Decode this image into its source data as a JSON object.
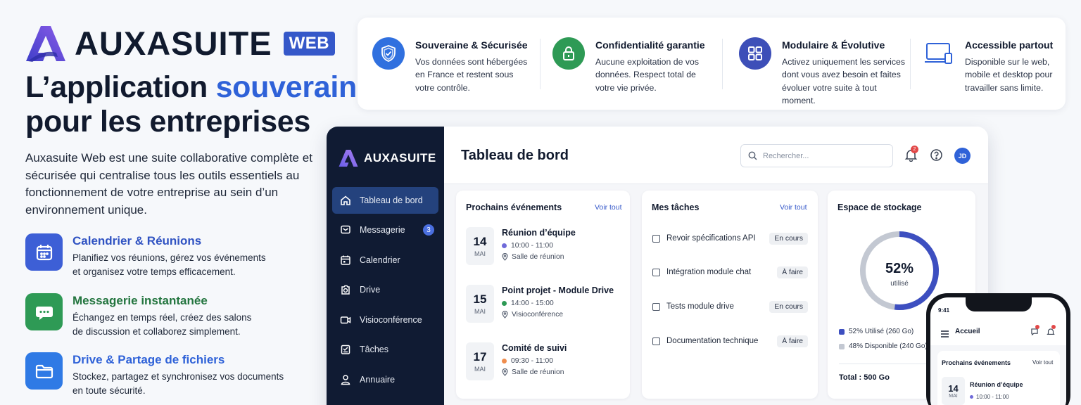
{
  "brand": {
    "name": "AUXASUITE",
    "tag": "WEB"
  },
  "headline": {
    "part1": "L’application ",
    "highlight": "souveraine",
    "line2": "pour les entreprises"
  },
  "intro": "Auxasuite Web est une suite collaborative complète et sécurisée qui centralise tous les outils essentiels au fonctionnement de votre entreprise au sein d’un environnement unique.",
  "features": [
    {
      "title": "Calendrier & Réunions",
      "desc1": "Planifiez vos réunions, gérez vos événements",
      "desc2": "et organisez votre temps efficacement.",
      "color": "#3d5fd6",
      "icon": "calendar-icon"
    },
    {
      "title": "Messagerie instantanée",
      "desc1": "Échangez en temps réel, créez des salons",
      "desc2": "de discussion et collaborez simplement.",
      "color": "#2e9a55",
      "icon": "chat-icon"
    },
    {
      "title": "Drive & Partage de fichiers",
      "desc1": "Stockez, partagez et synchronisez vos documents",
      "desc2": "en toute sécurité.",
      "color": "#2f7ae5",
      "icon": "folder-icon"
    }
  ],
  "topbar": [
    {
      "title": "Souveraine & Sécurisée",
      "lines": [
        "Vos données sont hébergées",
        "en France et restent sous",
        "votre contrôle."
      ],
      "color": "#3070df",
      "icon": "shield-icon"
    },
    {
      "title": "Confidentialité garantie",
      "lines": [
        "Aucune exploitation de vos",
        "données. Respect total de",
        "votre vie privée."
      ],
      "color": "#2e9a55",
      "icon": "lock-icon"
    },
    {
      "title": "Modulaire & Évolutive",
      "lines": [
        "Activez uniquement les services",
        "dont vous avez besoin et faites",
        "évoluer votre suite à tout moment."
      ],
      "color": "#3d4fb8",
      "icon": "modules-icon"
    },
    {
      "title": "Accessible partout",
      "lines": [
        "Disponible sur le web,",
        "mobile et desktop pour",
        "travailler sans limite."
      ],
      "color": "#2f62d8",
      "icon": "laptop-icon"
    }
  ],
  "app": {
    "brand": "AUXASUITE",
    "nav": [
      {
        "label": "Tableau de bord",
        "icon": "home-icon",
        "active": true
      },
      {
        "label": "Messagerie",
        "icon": "message-icon",
        "badge": "3"
      },
      {
        "label": "Calendrier",
        "icon": "calendar-icon"
      },
      {
        "label": "Drive",
        "icon": "drive-icon"
      },
      {
        "label": "Visioconférence",
        "icon": "video-icon"
      },
      {
        "label": "Tâches",
        "icon": "tasks-icon"
      },
      {
        "label": "Annuaire",
        "icon": "user-icon"
      }
    ],
    "title": "Tableau de bord",
    "search_placeholder": "Rechercher...",
    "notifications": "2",
    "avatar": "JD",
    "events_card": {
      "title": "Prochains événements",
      "more": "Voir tout",
      "events": [
        {
          "day": "14",
          "month": "MAI",
          "title": "Réunion d’équipe",
          "time": "10:00 - 11:00",
          "place": "Salle de réunion",
          "color": "#6f6ad9"
        },
        {
          "day": "15",
          "month": "MAI",
          "title": "Point projet - Module Drive",
          "time": "14:00 - 15:00",
          "place": "Visioconférence",
          "color": "#2e9a55"
        },
        {
          "day": "17",
          "month": "MAI",
          "title": "Comité de suivi",
          "time": "09:30 - 11:00",
          "place": "Salle de réunion",
          "color": "#ef8d4e"
        }
      ]
    },
    "tasks_card": {
      "title": "Mes tâches",
      "more": "Voir tout",
      "tasks": [
        {
          "label": "Revoir spécifications API",
          "status": "En cours"
        },
        {
          "label": "Intégration module chat",
          "status": "À faire"
        },
        {
          "label": "Tests module drive",
          "status": "En cours"
        },
        {
          "label": "Documentation technique",
          "status": "À faire"
        }
      ]
    },
    "storage_card": {
      "title": "Espace de stockage",
      "percent": "52%",
      "percent_value": 0.52,
      "caption": "utilisé",
      "used": "52% Utilisé (260 Go)",
      "free": "48% Disponible (240 Go)",
      "total": "Total : 500 Go",
      "used_color": "#3d4fc0",
      "free_color": "#c3c8d2"
    }
  },
  "phone": {
    "time": "9:41",
    "title": "Accueil",
    "section": "Prochains événements",
    "more": "Voir tout",
    "event": {
      "day": "14",
      "month": "MAI",
      "title": "Réunion d’équipe",
      "time": "10:00 - 11:00"
    }
  }
}
